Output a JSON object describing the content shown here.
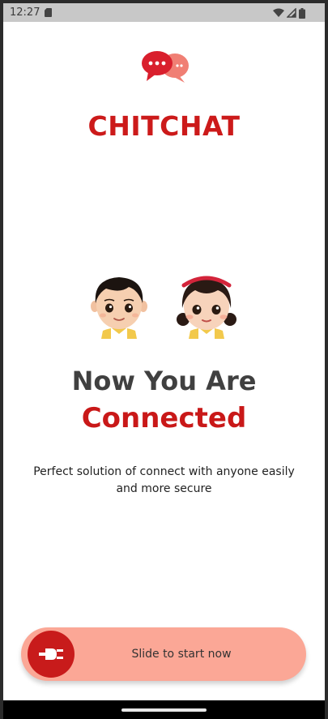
{
  "status_bar": {
    "time": "12:27",
    "icons": [
      "sd-card-icon",
      "wifi-icon",
      "signal-icon",
      "battery-icon"
    ]
  },
  "app": {
    "name": "CHITCHAT",
    "logo_icon": "chat-bubbles-icon",
    "brand_color": "#cc1a1a"
  },
  "onboarding": {
    "headline_line1": "Now You Are",
    "headline_line2": "Connected",
    "subtitle": "Perfect solution of connect with anyone easily and more secure",
    "avatars": [
      "boy-avatar",
      "girl-avatar"
    ]
  },
  "slider": {
    "label": "Slide to start now",
    "knob_icon": "plug-icon",
    "track_color": "#fba796",
    "knob_color": "#c81b1b"
  }
}
